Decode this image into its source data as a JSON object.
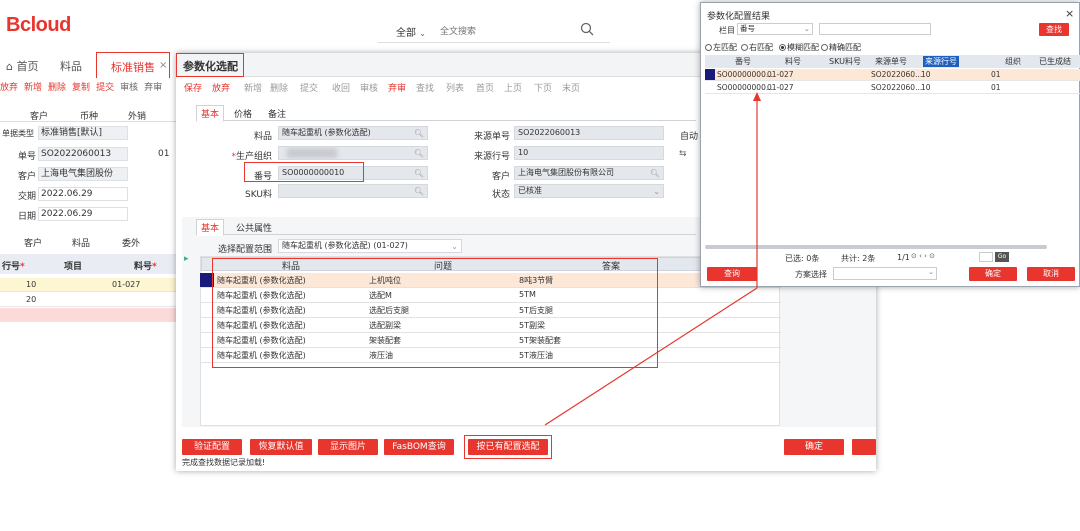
{
  "app": {
    "logo": "cloud",
    "logo_mark": "B"
  },
  "search": {
    "scope": "全部",
    "placeholder": "全文搜索"
  },
  "main_tabs": {
    "home": "首页",
    "material": "料品",
    "sales": "标准销售"
  },
  "bg_toolbar": [
    "放弃",
    "新增",
    "删除",
    "复制",
    "提交",
    "审核",
    "弃审"
  ],
  "bg_form": {
    "tabs": [
      "客户",
      "币种",
      "外销"
    ],
    "doc_type_label": "单据类型",
    "doc_type": "标准销售[默认]",
    "doc_no_label": "单号",
    "doc_no": "SO2022060013",
    "doc_no_extra": "01",
    "customer_label": "客户",
    "customer": "上海电气集团股份",
    "delivery_date_label": "交期",
    "delivery_date": "2022.06.29",
    "date_label": "日期",
    "date": "2022.06.29",
    "detail_tabs": [
      "客户",
      "料品",
      "委外"
    ],
    "grid_headers": [
      "行号",
      "项目",
      "料号"
    ],
    "grid_rows": [
      {
        "line": "10",
        "item": "",
        "code": "01-027"
      },
      {
        "line": "20",
        "item": "",
        "code": ""
      }
    ]
  },
  "dialog1": {
    "title": "参数化选配",
    "toolbar": [
      "保存",
      "放弃",
      "新增",
      "删除",
      "提交",
      "收回",
      "审核",
      "弃审",
      "查找",
      "列表",
      "首页",
      "上页",
      "下页",
      "末页"
    ],
    "tabs": [
      "基本",
      "价格",
      "备注"
    ],
    "fields": {
      "item_label": "料品",
      "item": "随车起重机 (参数化选配)",
      "org_label": "生产组织",
      "org": "",
      "code_label": "番号",
      "code": "SO0000000010",
      "sku_label": "SKU料",
      "sku": "",
      "source_no_label": "来源单号",
      "source_no": "SO2022060013",
      "source_line_label": "来源行号",
      "source_line": "10",
      "customer_label": "客户",
      "customer": "上海电气集团股份有限公司",
      "status_label": "状态",
      "status": "已核准",
      "auto_label": "自动"
    },
    "sub_tabs": [
      "基本",
      "公共属性"
    ],
    "config_range_label": "选择配置范围",
    "config_range": "随车起重机 (参数化选配) (01-027)",
    "grid_headers": [
      "料品",
      "问题",
      "答案"
    ],
    "grid_rows": [
      {
        "item": "随车起重机 (参数化选配)",
        "question": "上机吨位",
        "answer": "8吨3节臂"
      },
      {
        "item": "随车起重机 (参数化选配)",
        "question": "选配M",
        "answer": "5TM"
      },
      {
        "item": "随车起重机 (参数化选配)",
        "question": "选配后支腿",
        "answer": "5T后支腿"
      },
      {
        "item": "随车起重机 (参数化选配)",
        "question": "选配副梁",
        "answer": "5T副梁"
      },
      {
        "item": "随车起重机 (参数化选配)",
        "question": "架装配套",
        "answer": "5T架装配套"
      },
      {
        "item": "随车起重机 (参数化选配)",
        "question": "液压油",
        "answer": "5T液压油"
      }
    ],
    "buttons": {
      "verify": "验证配置",
      "restore": "恢复默认值",
      "show_image": "显示图片",
      "fasbom": "FasBOM查询",
      "by_config": "按已有配置选配",
      "ok": "确定"
    },
    "status_message": "完成查找数据记录加载!"
  },
  "dialog2": {
    "title": "参数化配置结果",
    "field_label": "栏目",
    "field_value": "番号",
    "find_button": "查找",
    "match_options": [
      "左匹配",
      "右匹配",
      "模糊匹配",
      "精确匹配"
    ],
    "match_selected": "模糊匹配",
    "grid_headers": [
      "番号",
      "料号",
      "SKU料号",
      "来源单号",
      "来源行号",
      "组织",
      "已生成结"
    ],
    "grid_rows": [
      {
        "code": "SO00000000...",
        "item": "01-027",
        "sku": "",
        "source_no": "SO2022060...",
        "source_line": "10",
        "org": "01"
      },
      {
        "code": "SO00000000...",
        "item": "01-027",
        "sku": "",
        "source_no": "SO2022060...",
        "source_line": "10",
        "org": "01"
      }
    ],
    "selected_text": "已选: 0条",
    "total_text": "共计: 2条",
    "page_text": "1/1",
    "go_button": "Go",
    "query_button": "查询",
    "scheme_label": "方案选择",
    "ok_button": "确定",
    "cancel_button": "取消"
  },
  "colors": {
    "accent": "#e8352e",
    "grid_header": "#e3e7ee",
    "selected_row": "#fde8d8"
  }
}
